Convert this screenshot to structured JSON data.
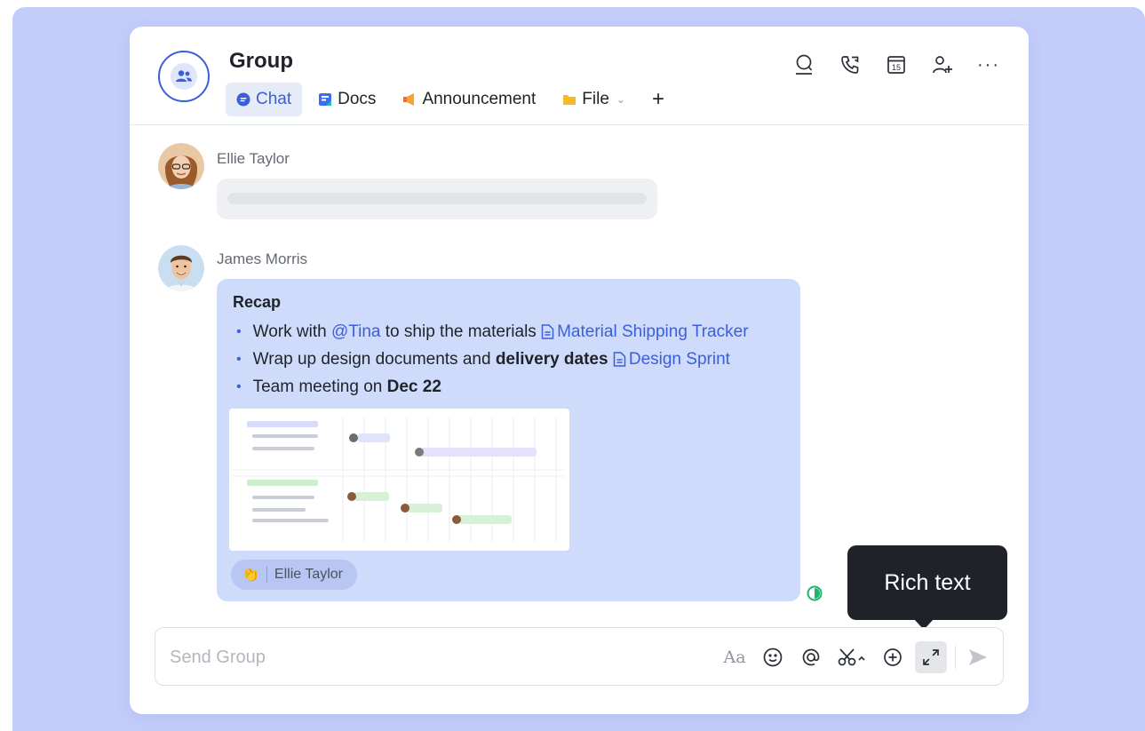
{
  "header": {
    "title": "Group",
    "tabs": [
      {
        "label": "Chat",
        "icon": "chat-bubble-icon",
        "active": true
      },
      {
        "label": "Docs",
        "icon": "docs-icon",
        "active": false
      },
      {
        "label": "Announcement",
        "icon": "megaphone-icon",
        "active": false
      },
      {
        "label": "File",
        "icon": "folder-icon",
        "active": false,
        "has_dropdown": true
      }
    ],
    "add_tab_label": "+",
    "actions": [
      "search-member-icon",
      "call-icon",
      "calendar-icon",
      "add-member-icon",
      "more-icon"
    ],
    "calendar_day": "15",
    "more_label": "···"
  },
  "messages": [
    {
      "sender": "Ellie Taylor",
      "placeholder": true
    },
    {
      "sender": "James Morris",
      "recap": {
        "title": "Recap",
        "items": [
          {
            "pre": "Work with ",
            "mention": "@Tina",
            "mid": " to ship the materials ",
            "link": "Material Shipping Tracker"
          },
          {
            "pre": "Wrap up design documents and ",
            "bold": "delivery dates",
            "mid": " ",
            "link": "Design Sprint"
          },
          {
            "pre": "Team meeting on ",
            "bold": "Dec 22"
          }
        ]
      },
      "reaction": {
        "emoji": "👏",
        "name": "Ellie Taylor"
      }
    }
  ],
  "tooltip": "Rich text",
  "composer": {
    "placeholder": "Send Group",
    "text_format_label": "Aa",
    "tools": [
      "text-format-icon",
      "emoji-icon",
      "mention-icon",
      "scissors-icon",
      "add-circle-icon",
      "expand-icon",
      "send-icon"
    ]
  },
  "colors": {
    "accent": "#3a5fd9",
    "backdrop": "#c3cdfa",
    "bubble": "#cfdbfb",
    "tooltip": "#1f2329"
  }
}
